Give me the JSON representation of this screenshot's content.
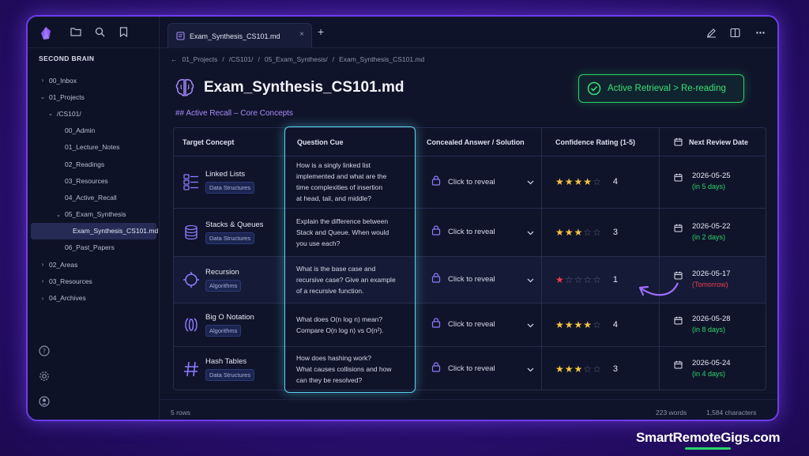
{
  "sidebar": {
    "vault_title": "SECOND BRAIN",
    "items": [
      {
        "label": "00_Inbox",
        "chev": "›",
        "depth": 0
      },
      {
        "label": "01_Projects",
        "chev": "⌄",
        "depth": 0
      },
      {
        "label": "/CS101/",
        "chev": "⌄",
        "depth": 1
      },
      {
        "label": "00_Admin",
        "chev": "",
        "depth": 2
      },
      {
        "label": "01_Lecture_Notes",
        "chev": "",
        "depth": 2
      },
      {
        "label": "02_Readings",
        "chev": "",
        "depth": 2
      },
      {
        "label": "03_Resources",
        "chev": "",
        "depth": 2
      },
      {
        "label": "04_Active_Recall",
        "chev": "",
        "depth": 2
      },
      {
        "label": "05_Exam_Synthesis",
        "chev": "⌄",
        "depth": 2
      },
      {
        "label": "Exam_Synthesis_CS101.md",
        "chev": "",
        "depth": 3,
        "active": true
      },
      {
        "label": "06_Past_Papers",
        "chev": "",
        "depth": 2
      },
      {
        "label": "02_Areas",
        "chev": "›",
        "depth": 0
      },
      {
        "label": "03_Resources",
        "chev": "›",
        "depth": 0
      },
      {
        "label": "04_Archives",
        "chev": "›",
        "depth": 0
      }
    ]
  },
  "tab": {
    "label": "Exam_Synthesis_CS101.md",
    "close": "×",
    "new_tab": "+"
  },
  "breadcrumb": {
    "back": "←",
    "parts": [
      "01_Projects",
      "/",
      "/CS101/",
      "/",
      "05_Exam_Synthesis/",
      "/",
      "Exam_Synthesis_CS101.md"
    ]
  },
  "doc": {
    "title": "Exam_Synthesis_CS101.md",
    "heading": "## Active Recall – Core Concepts",
    "badge": "Active Retrieval > Re-reading"
  },
  "table": {
    "headers": {
      "concept": "Target Concept",
      "cue": "Question Cue",
      "answer": "Concealed Answer / Solution",
      "confidence": "Confidence Rating (1-5)",
      "review": "Next Review Date"
    },
    "reveal_label": "Click to reveal",
    "rows": [
      {
        "concept": "Linked Lists",
        "tag": "Data Structures",
        "icon": "linked-list-icon",
        "cue": [
          "How is a singly linked list",
          "implemented and what are the",
          "time complexities of insertion",
          "at head, tail, and middle?"
        ],
        "rating": 4,
        "rating_text": "4",
        "date": "2026-05-25",
        "relative": "(in 5 days)",
        "urgent": false
      },
      {
        "concept": "Stacks & Queues",
        "tag": "Data Structures",
        "icon": "stack-icon",
        "cue": [
          "Explain the difference between",
          "Stack and Queue. When would",
          "you use each?"
        ],
        "rating": 3,
        "rating_text": "3",
        "date": "2026-05-22",
        "relative": "(in 2 days)",
        "urgent": false
      },
      {
        "concept": "Recursion",
        "tag": "Algorithms",
        "icon": "recursion-icon",
        "cue": [
          "What is the base case and",
          "recursive case? Give an example",
          "of a recursive function."
        ],
        "rating": 1,
        "rating_text": "1",
        "date": "2026-05-17",
        "relative": "(Tomorrow)",
        "urgent": true
      },
      {
        "concept": "Big O Notation",
        "tag": "Algorithms",
        "icon": "big-o-icon",
        "cue": [
          "What does O(n log n) mean?",
          "Compare O(n log n) vs O(n²)."
        ],
        "rating": 4,
        "rating_text": "4",
        "date": "2026-05-28",
        "relative": "(in 8 days)",
        "urgent": false
      },
      {
        "concept": "Hash Tables",
        "tag": "Data Structures",
        "icon": "hash-icon",
        "cue": [
          "How does hashing work?",
          "What causes collisions and how",
          "can they be resolved?"
        ],
        "rating": 3,
        "rating_text": "3",
        "date": "2026-05-24",
        "relative": "(in 4 days)",
        "urgent": false
      }
    ]
  },
  "footer": {
    "rows": "5 rows",
    "words": "223 words",
    "chars": "1,584 characters"
  },
  "watermark": "SmartRemoteGigs.com",
  "colors": {
    "accent": "#6d3df0",
    "success": "#2bd46b",
    "star": "#f5c542",
    "urgent": "#ef3b4f",
    "cue_highlight": "#5ad2e8"
  }
}
